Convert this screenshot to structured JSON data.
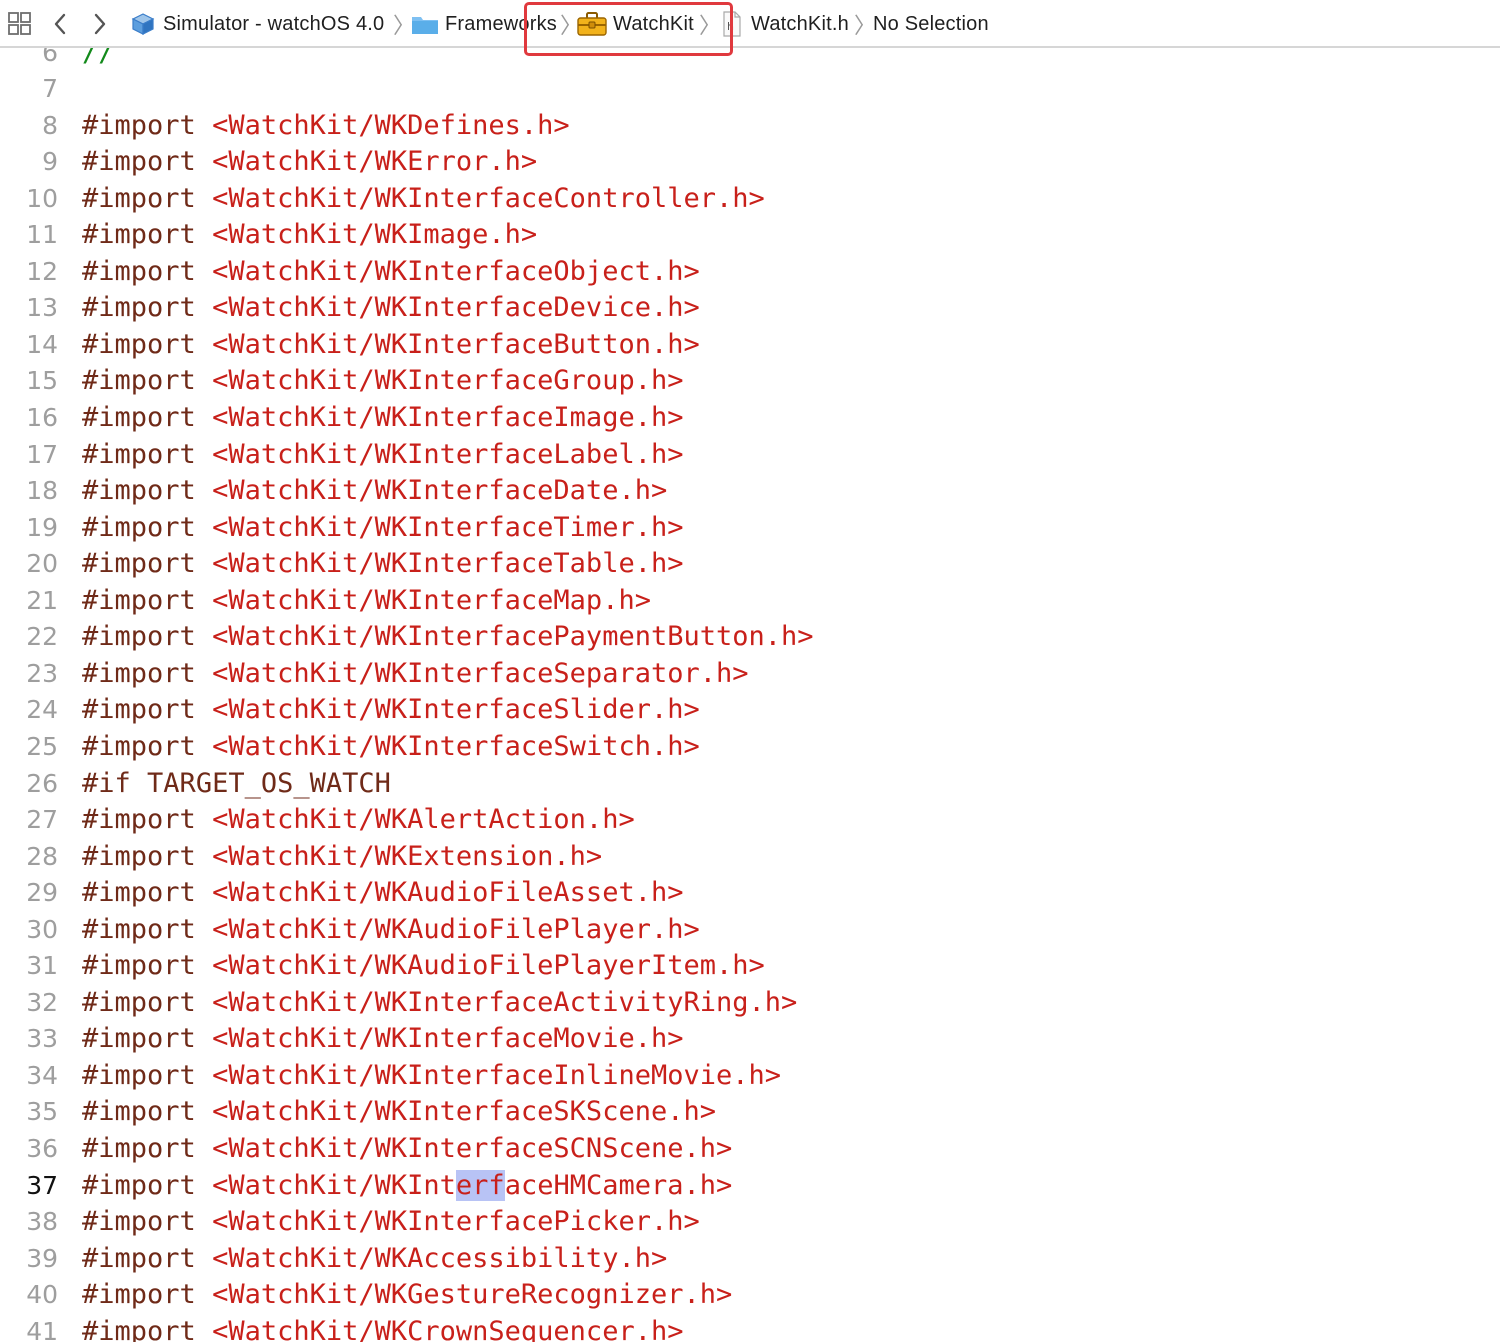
{
  "jumpbar": {
    "breadcrumbs": [
      {
        "label": "Simulator - watchOS 4.0",
        "icon": "sdk-cube-icon"
      },
      {
        "label": "Frameworks",
        "icon": "folder-icon"
      },
      {
        "label": "WatchKit",
        "icon": "toolbox-icon"
      },
      {
        "label": "WatchKit.h",
        "icon": "header-file-icon"
      },
      {
        "label": "No Selection",
        "icon": ""
      }
    ],
    "icons": {
      "grid": "grid-icon",
      "back": "chevron-left-icon",
      "forward": "chevron-right-icon"
    }
  },
  "editor": {
    "current_line": "37",
    "selected_text": "erf",
    "colors": {
      "keyword": "#6f2a18",
      "string": "#c8201a",
      "comment": "#138a1b",
      "selection": "#b8c3f5"
    },
    "lines": [
      {
        "num": "6",
        "kw": "",
        "arg": "",
        "comment": "//"
      },
      {
        "num": "7",
        "kw": "",
        "arg": "",
        "comment": ""
      },
      {
        "num": "8",
        "kw": "#import",
        "arg": "<WatchKit/WKDefines.h>"
      },
      {
        "num": "9",
        "kw": "#import",
        "arg": "<WatchKit/WKError.h>"
      },
      {
        "num": "10",
        "kw": "#import",
        "arg": "<WatchKit/WKInterfaceController.h>"
      },
      {
        "num": "11",
        "kw": "#import",
        "arg": "<WatchKit/WKImage.h>"
      },
      {
        "num": "12",
        "kw": "#import",
        "arg": "<WatchKit/WKInterfaceObject.h>"
      },
      {
        "num": "13",
        "kw": "#import",
        "arg": "<WatchKit/WKInterfaceDevice.h>"
      },
      {
        "num": "14",
        "kw": "#import",
        "arg": "<WatchKit/WKInterfaceButton.h>"
      },
      {
        "num": "15",
        "kw": "#import",
        "arg": "<WatchKit/WKInterfaceGroup.h>"
      },
      {
        "num": "16",
        "kw": "#import",
        "arg": "<WatchKit/WKInterfaceImage.h>"
      },
      {
        "num": "17",
        "kw": "#import",
        "arg": "<WatchKit/WKInterfaceLabel.h>"
      },
      {
        "num": "18",
        "kw": "#import",
        "arg": "<WatchKit/WKInterfaceDate.h>"
      },
      {
        "num": "19",
        "kw": "#import",
        "arg": "<WatchKit/WKInterfaceTimer.h>"
      },
      {
        "num": "20",
        "kw": "#import",
        "arg": "<WatchKit/WKInterfaceTable.h>"
      },
      {
        "num": "21",
        "kw": "#import",
        "arg": "<WatchKit/WKInterfaceMap.h>"
      },
      {
        "num": "22",
        "kw": "#import",
        "arg": "<WatchKit/WKInterfacePaymentButton.h>"
      },
      {
        "num": "23",
        "kw": "#import",
        "arg": "<WatchKit/WKInterfaceSeparator.h>"
      },
      {
        "num": "24",
        "kw": "#import",
        "arg": "<WatchKit/WKInterfaceSlider.h>"
      },
      {
        "num": "25",
        "kw": "#import",
        "arg": "<WatchKit/WKInterfaceSwitch.h>"
      },
      {
        "num": "26",
        "kw": "#if",
        "arg": "TARGET_OS_WATCH",
        "plain": true
      },
      {
        "num": "27",
        "kw": "#import",
        "arg": "<WatchKit/WKAlertAction.h>"
      },
      {
        "num": "28",
        "kw": "#import",
        "arg": "<WatchKit/WKExtension.h>"
      },
      {
        "num": "29",
        "kw": "#import",
        "arg": "<WatchKit/WKAudioFileAsset.h>"
      },
      {
        "num": "30",
        "kw": "#import",
        "arg": "<WatchKit/WKAudioFilePlayer.h>"
      },
      {
        "num": "31",
        "kw": "#import",
        "arg": "<WatchKit/WKAudioFilePlayerItem.h>"
      },
      {
        "num": "32",
        "kw": "#import",
        "arg": "<WatchKit/WKInterfaceActivityRing.h>"
      },
      {
        "num": "33",
        "kw": "#import",
        "arg": "<WatchKit/WKInterfaceMovie.h>"
      },
      {
        "num": "34",
        "kw": "#import",
        "arg": "<WatchKit/WKInterfaceInlineMovie.h>"
      },
      {
        "num": "35",
        "kw": "#import",
        "arg": "<WatchKit/WKInterfaceSKScene.h>"
      },
      {
        "num": "36",
        "kw": "#import",
        "arg": "<WatchKit/WKInterfaceSCNScene.h>"
      },
      {
        "num": "37",
        "kw": "#import",
        "arg": "<WatchKit/WKInterfaceHMCamera.h>"
      },
      {
        "num": "38",
        "kw": "#import",
        "arg": "<WatchKit/WKInterfacePicker.h>"
      },
      {
        "num": "39",
        "kw": "#import",
        "arg": "<WatchKit/WKAccessibility.h>"
      },
      {
        "num": "40",
        "kw": "#import",
        "arg": "<WatchKit/WKGestureRecognizer.h>"
      },
      {
        "num": "41",
        "kw": "#import",
        "arg": "<WatchKit/WKCrownSequencer.h>"
      }
    ]
  }
}
